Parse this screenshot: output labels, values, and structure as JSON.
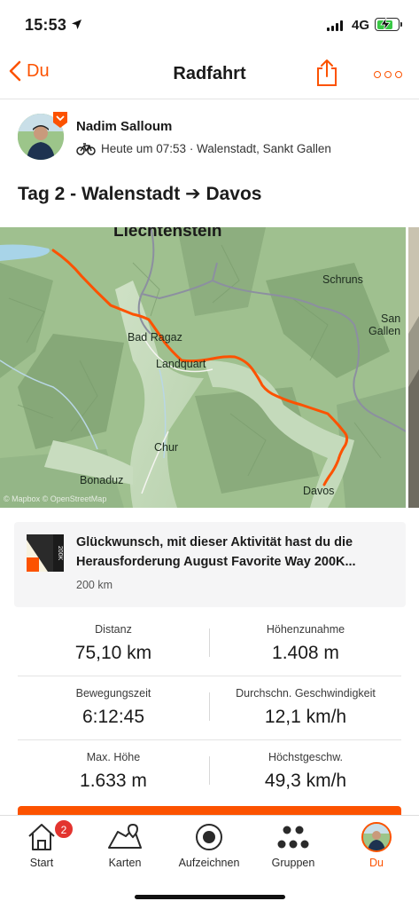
{
  "status_bar": {
    "time": "15:53",
    "network": "4G",
    "battery_level": 0.65
  },
  "nav": {
    "back_label": "Du",
    "title": "Radfahrt"
  },
  "athlete": {
    "name": "Nadim Salloum",
    "meta": "Heute um 07:53 · Walenstadt, Sankt Gallen",
    "sport_icon": "bike-icon"
  },
  "activity": {
    "title": "Tag 2 - Walenstadt ➔ Davos"
  },
  "map": {
    "labels": {
      "liechtenstein": "Liechtenstein",
      "schruns": "Schruns",
      "sankt_gallenkirch_1": "San",
      "sankt_gallenkirch_2": "Gallen",
      "bad_ragaz": "Bad Ragaz",
      "landquart": "Landquart",
      "chur": "Chur",
      "bonaduz": "Bonaduz",
      "davos": "Davos"
    },
    "attribution": "© Mapbox © OpenStreetMap",
    "route_color": "#fc5200"
  },
  "challenge": {
    "text": "Glückwunsch, mit dieser Aktivität hast du die Herausforderung August Favorite Way 200K...",
    "sub": "200 km",
    "badge_label": "200K"
  },
  "stats": [
    {
      "left_label": "Distanz",
      "left_value": "75,10 km",
      "right_label": "Höhenzunahme",
      "right_value": "1.408 m"
    },
    {
      "left_label": "Bewegungszeit",
      "left_value": "6:12:45",
      "right_label": "Durchschn. Geschwindigkeit",
      "right_value": "12,1 km/h"
    },
    {
      "left_label": "Max. Höhe",
      "left_value": "1.633 m",
      "right_label": "Höchstgeschw.",
      "right_value": "49,3 km/h"
    }
  ],
  "tabbar": {
    "items": [
      {
        "label": "Start",
        "icon": "home-icon",
        "badge": "2"
      },
      {
        "label": "Karten",
        "icon": "map-pin-icon"
      },
      {
        "label": "Aufzeichnen",
        "icon": "record-icon"
      },
      {
        "label": "Gruppen",
        "icon": "groups-icon"
      },
      {
        "label": "Du",
        "icon": "avatar",
        "active": true
      }
    ]
  },
  "colors": {
    "accent": "#fc5200",
    "badge": "#e3342f"
  }
}
